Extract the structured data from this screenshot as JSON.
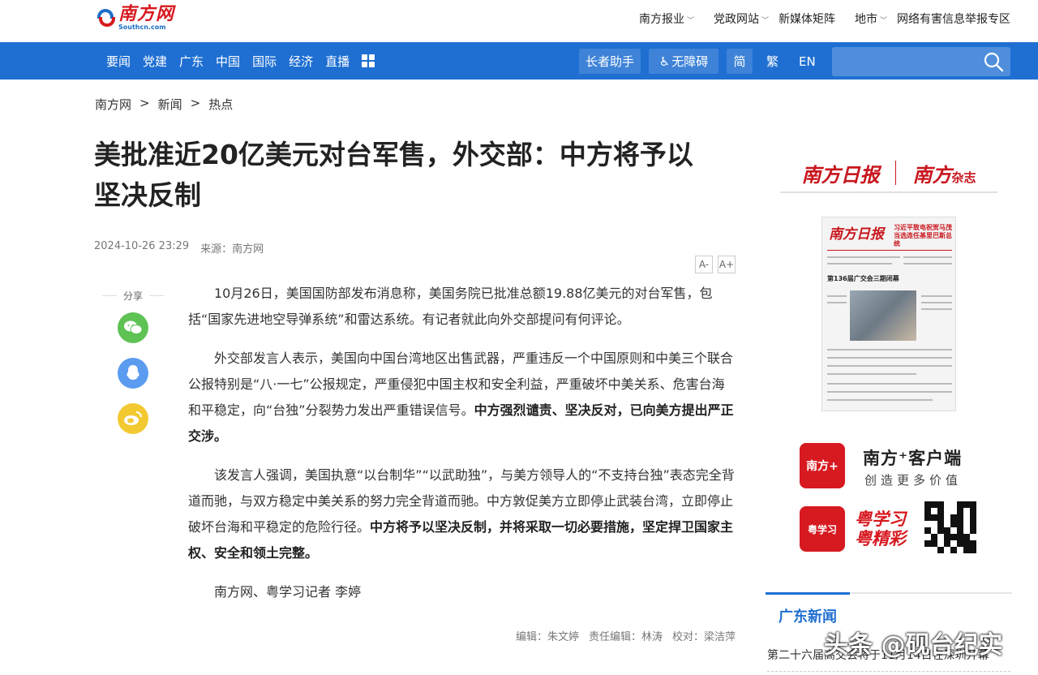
{
  "brand": {
    "name_cn": "南方网",
    "name_en": "Southcn.com"
  },
  "top_links": [
    {
      "label": "南方报业",
      "dropdown": true
    },
    {
      "label": "党政网站",
      "dropdown": true
    },
    {
      "label": "新媒体矩阵",
      "dropdown": false
    },
    {
      "label": "地市",
      "dropdown": true
    },
    {
      "label": "网络有害信息举报专区",
      "dropdown": false
    }
  ],
  "nav": {
    "items": [
      "要闻",
      "党建",
      "广东",
      "中国",
      "国际",
      "经济",
      "直播"
    ],
    "helper_btn": "长者助手",
    "accessible_btn": "无障碍",
    "simplified": "简",
    "traditional": "繁",
    "english": "EN",
    "search_placeholder": ""
  },
  "breadcrumb": [
    "南方网",
    "新闻",
    "热点"
  ],
  "article": {
    "title": "美批准近20亿美元对台军售，外交部：中方将予以坚决反制",
    "date": "2024-10-26 23:29",
    "source": "来源：南方网",
    "font_decrease": "A-",
    "font_increase": "A+",
    "paragraphs": [
      {
        "text": "10月26日，美国国防部发布消息称，美国务院已批准总额19.88亿美元的对台军售，包括“国家先进地空导弹系统”和雷达系统。有记者就此向外交部提问有何评论。",
        "bold": ""
      },
      {
        "text": "外交部发言人表示，美国向中国台湾地区出售武器，严重违反一个中国原则和中美三个联合公报特别是“八·一七”公报规定，严重侵犯中国主权和安全利益，严重破坏中美关系、危害台海和平稳定，向“台独”分裂势力发出严重错误信号。",
        "bold": "中方强烈谴责、坚决反对，已向美方提出严正交涉。"
      },
      {
        "text": "该发言人强调，美国执意“以台制华”“以武助独”，与美方领导人的“不支持台独”表态完全背道而驰，与双方稳定中美关系的努力完全背道而驰。中方敦促美方立即停止武装台湾，立即停止破坏台海和平稳定的危险行径。",
        "bold": "中方将予以坚决反制，并将采取一切必要措施，坚定捍卫国家主权、安全和领土完整。"
      },
      {
        "text": "南方网、粤学习记者 李婷",
        "bold": ""
      }
    ],
    "editor": "编辑：朱文婷",
    "chief_editor": "责任编辑：林涛",
    "proofreader": "校对：梁洁萍"
  },
  "share": {
    "label": "分享",
    "targets": [
      "wechat",
      "qq",
      "weibo"
    ]
  },
  "sidebar": {
    "paper_brand1": "南方日报",
    "paper_brand2": "南方",
    "paper_brand2_suffix": "杂志",
    "newspaper_masthead": "南方日报",
    "newspaper_headline": "习近平致电祝贺马茂当选连任基里巴斯总统",
    "newspaper_sub": "第136届广交会三期闭幕",
    "app1_icon": "南方+",
    "app1_title": "南方⁺客户端",
    "app1_sub": "创造更多价值",
    "app2_icon": "粤学习",
    "app2_line1": "粤学习",
    "app2_line2": "粤精彩",
    "gd_title": "广东新闻",
    "gd_item": "第二十六届高交会将于11月14日在深圳开幕"
  },
  "watermark": "头条 @砚台纪实",
  "colors": {
    "nav_blue": "#1f6fd2",
    "brand_red": "#d71920"
  }
}
